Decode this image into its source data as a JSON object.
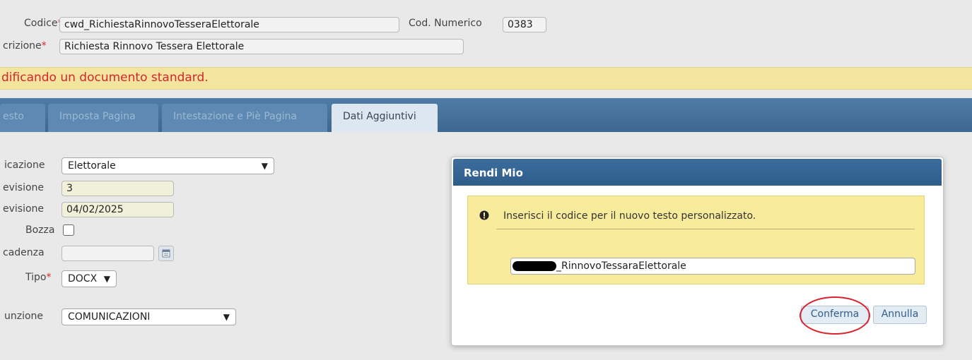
{
  "form": {
    "codice_label": "Codice",
    "codice_value": "cwd_RichiestaRinnovoTesseraElettorale",
    "cod_numerico_label": "Cod. Numerico",
    "cod_numerico_value": "0383",
    "descrizione_label": "crizione",
    "descrizione_value": "Richiesta Rinnovo Tessera Elettorale",
    "required_marker": "*"
  },
  "warning": {
    "text": "dificando un documento standard."
  },
  "tabs": [
    {
      "label": "esto"
    },
    {
      "label": "Imposta Pagina"
    },
    {
      "label": "Intestazione e Piè Pagina"
    },
    {
      "label": "Dati Aggiuntivi",
      "active": true
    }
  ],
  "details": {
    "classificazione_label": "icazione",
    "classificazione_value": "Elettorale",
    "num_revisione_label": "evisione",
    "num_revisione_value": "3",
    "data_revisione_label": "evisione",
    "data_revisione_value": "04/02/2025",
    "bozza_label": "Bozza",
    "scadenza_label": "cadenza",
    "scadenza_value": "",
    "tipo_label": "Tipo",
    "tipo_value": "DOCX",
    "funzione_label": "unzione",
    "funzione_value": "COMUNICAZIONI"
  },
  "dialog": {
    "title": "Rendi Mio",
    "message": "Inserisci il codice per il nuovo testo personalizzato.",
    "input_value": "_RinnovoTessaraElettorale",
    "confirm_label": "Conferma",
    "cancel_label": "Annulla"
  },
  "icons": {
    "info": "exclamation-circle-icon",
    "calendar": "calendar-icon",
    "dropdown": "chevron-down-icon"
  },
  "colors": {
    "required": "#d9232e",
    "tab_bar": "#3e6790",
    "warning_bg": "#f3e59d",
    "dialog_panel": "#f8ec9c",
    "highlight_circle": "#d9232e"
  }
}
